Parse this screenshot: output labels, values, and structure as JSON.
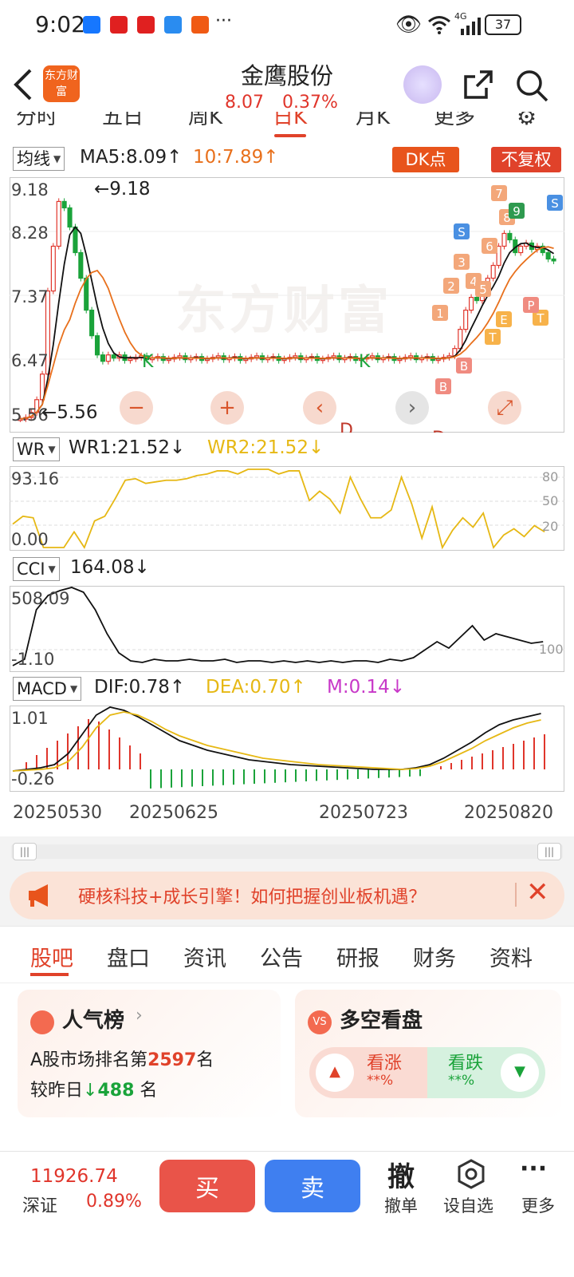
{
  "status_bar": {
    "time": "9:02",
    "battery": "37",
    "network": "4G"
  },
  "header": {
    "logo_text": "东方财富",
    "title": "金鹰股份",
    "price": "8.07",
    "change_pct": "0.37%"
  },
  "period_tabs": [
    "分时",
    "五日",
    "周K",
    "日K",
    "月K",
    "更多"
  ],
  "main_chart": {
    "indicator": "均线",
    "ma5_label": "MA5:8.09",
    "ma10_label": "10:7.89",
    "dk_button": "DK点",
    "fq_button": "不复权",
    "y_ticks": [
      "9.18",
      "8.28",
      "7.37",
      "6.47",
      "5.56"
    ],
    "high_marker": "←9.18",
    "low_marker": "←5.56",
    "watermark": "东方财富",
    "controls": [
      "−",
      "+",
      "‹",
      "›",
      "⤢"
    ]
  },
  "wr": {
    "indicator": "WR",
    "wr1": "WR1:21.52",
    "wr2": "WR2:21.52",
    "y_top": "93.16",
    "y_bottom": "0.00",
    "r80": "80",
    "r50": "50",
    "r20": "20"
  },
  "cci": {
    "indicator": "CCI",
    "value": "164.08",
    "y_top": "508.09",
    "y_bottom": "-1.10",
    "r100": "100"
  },
  "macd": {
    "indicator": "MACD",
    "dif": "DIF:0.78",
    "dea": "DEA:0.70",
    "m": "M:0.14",
    "y_top": "1.01",
    "y_bottom": "-0.26"
  },
  "x_dates": [
    "20250530",
    "20250625",
    "20250723",
    "20250820"
  ],
  "promo": {
    "text": "硬核科技+成长引擎！如何把握创业板机遇？"
  },
  "bottom_tabs": [
    "股吧",
    "盘口",
    "资讯",
    "公告",
    "研报",
    "财务",
    "资料"
  ],
  "popularity_card": {
    "title": "人气榜",
    "rank_prefix": "A股市场排名第",
    "rank": "2597",
    "rank_suffix": "名",
    "change_prefix": "较昨日",
    "change": "488",
    "change_suffix": "名"
  },
  "longshort_card": {
    "title": "多空看盘",
    "up_label": "看涨",
    "up_value": "**%",
    "down_label": "看跌",
    "down_value": "**%"
  },
  "bottom_bar": {
    "index_value": "11926.74",
    "index_name": "深证",
    "index_change": "0.89%",
    "buy": "买",
    "sell": "卖",
    "cancel_icon": "撤",
    "cancel": "撤单",
    "self_select": "设自选",
    "more": "更多"
  },
  "colors": {
    "up": "#e0352b",
    "down": "#1aa33a",
    "ma10": "#e8701c",
    "wr2": "#e6b814",
    "m": "#c838c8",
    "accent": "#e8541c"
  }
}
